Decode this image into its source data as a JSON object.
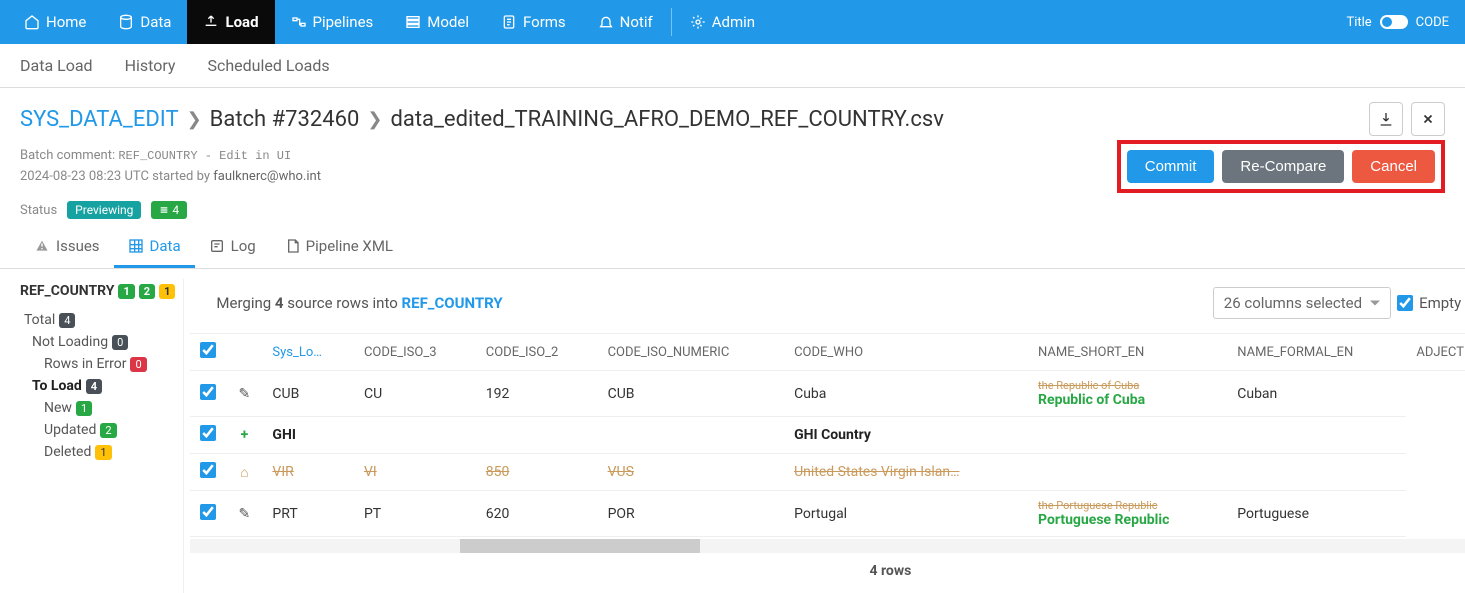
{
  "topnav": {
    "items": [
      {
        "label": "Home"
      },
      {
        "label": "Data"
      },
      {
        "label": "Load"
      },
      {
        "label": "Pipelines"
      },
      {
        "label": "Model"
      },
      {
        "label": "Forms"
      },
      {
        "label": "Notif"
      },
      {
        "label": "Admin"
      }
    ],
    "right": {
      "title": "Title",
      "code": "CODE"
    }
  },
  "subnav": [
    "Data Load",
    "History",
    "Scheduled Loads"
  ],
  "breadcrumb": {
    "root": "SYS_DATA_EDIT",
    "batch": "Batch #732460",
    "file": "data_edited_TRAINING_AFRO_DEMO_REF_COUNTRY.csv"
  },
  "meta": {
    "comment_label": "Batch comment:",
    "comment": "REF_COUNTRY - Edit in UI",
    "started": "2024-08-23 08:23 UTC started by",
    "user": "faulknerc@who.int",
    "status_label": "Status",
    "status_badge": "Previewing",
    "status_count": "4"
  },
  "actions": {
    "commit": "Commit",
    "recompare": "Re-Compare",
    "cancel": "Cancel"
  },
  "tabs": [
    "Issues",
    "Data",
    "Log",
    "Pipeline XML"
  ],
  "sidebar": {
    "title": "REF_COUNTRY",
    "title_badges": [
      "1",
      "2",
      "1"
    ],
    "items": [
      {
        "label": "Total",
        "badge": "4",
        "cls": "b-dark",
        "lvl": 0,
        "bold": false
      },
      {
        "label": "Not Loading",
        "badge": "0",
        "cls": "b-dark",
        "lvl": 1,
        "bold": false
      },
      {
        "label": "Rows in Error",
        "badge": "0",
        "cls": "b-red",
        "lvl": 2,
        "bold": false
      },
      {
        "label": "To Load",
        "badge": "4",
        "cls": "b-dark",
        "lvl": 1,
        "bold": true
      },
      {
        "label": "New",
        "badge": "1",
        "cls": "b-green",
        "lvl": 2,
        "bold": false
      },
      {
        "label": "Updated",
        "badge": "2",
        "cls": "b-green",
        "lvl": 2,
        "bold": false
      },
      {
        "label": "Deleted",
        "badge": "1",
        "cls": "b-yellow",
        "lvl": 2,
        "bold": false
      }
    ]
  },
  "tablebar": {
    "merge_prefix": "Merging",
    "merge_count": "4",
    "merge_mid": "source rows into",
    "merge_target": "REF_COUNTRY",
    "columns_select": "26 columns selected",
    "empty_cols": "Empty columns"
  },
  "table": {
    "headers": [
      "Sys_Lo…",
      "CODE_ISO_3",
      "CODE_ISO_2",
      "CODE_ISO_NUMERIC",
      "CODE_WHO",
      "NAME_SHORT_EN",
      "NAME_FORMAL_EN",
      "ADJECTIVE_PEOPLE"
    ],
    "rows": [
      {
        "type": "edit",
        "iso3": "CUB",
        "iso2": "CU",
        "num": "192",
        "who": "CUB",
        "short": "Cuba",
        "formal_old": "the Republic of Cuba",
        "formal_new": "Republic of Cuba",
        "adj": "Cuban"
      },
      {
        "type": "new",
        "iso3": "GHI",
        "iso2": "",
        "num": "",
        "who": "",
        "short": "GHI Country",
        "formal_old": "",
        "formal_new": "",
        "adj": ""
      },
      {
        "type": "del",
        "iso3": "VIR",
        "iso2": "VI",
        "num": "850",
        "who": "VUS",
        "short": "United States Virgin Islan…",
        "formal_old": "",
        "formal_new": "",
        "adj": ""
      },
      {
        "type": "edit",
        "iso3": "PRT",
        "iso2": "PT",
        "num": "620",
        "who": "POR",
        "short": "Portugal",
        "formal_old": "the Portuguese Republic",
        "formal_new": "Portuguese Republic",
        "adj": "Portuguese"
      }
    ],
    "footer": "4 rows"
  }
}
